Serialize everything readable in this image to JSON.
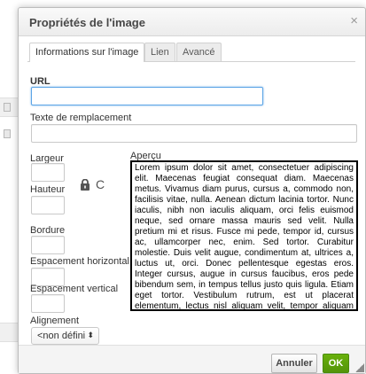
{
  "dialog": {
    "title": "Propriétés de l'image",
    "close_glyph": "×"
  },
  "tabs": [
    {
      "label": "Informations sur l'image",
      "active": true
    },
    {
      "label": "Lien",
      "active": false
    },
    {
      "label": "Avancé",
      "active": false
    }
  ],
  "fields": {
    "url": {
      "label": "URL",
      "value": ""
    },
    "alt_text": {
      "label": "Texte de remplacement",
      "value": ""
    },
    "width": {
      "label": "Largeur",
      "value": ""
    },
    "height": {
      "label": "Hauteur",
      "value": ""
    },
    "border": {
      "label": "Bordure",
      "value": ""
    },
    "hspace": {
      "label": "Espacement horizontal",
      "value": ""
    },
    "vspace": {
      "label": "Espacement vertical",
      "value": ""
    },
    "alignment": {
      "label": "Alignement",
      "selected": "<non défini",
      "arrow": "⬍"
    }
  },
  "icons": {
    "lock": "lock-icon",
    "reset_size": "refresh-icon",
    "reset_glyph": "C"
  },
  "preview": {
    "label": "Aperçu",
    "text": "Lorem ipsum dolor sit amet, consectetuer adipiscing elit. Maecenas feugiat consequat diam. Maecenas metus. Vivamus diam purus, cursus a, commodo non, facilisis vitae, nulla. Aenean dictum lacinia tortor. Nunc iaculis, nibh non iaculis aliquam, orci felis euismod neque, sed ornare massa mauris sed velit. Nulla pretium mi et risus. Fusce mi pede, tempor id, cursus ac, ullamcorper nec, enim. Sed tortor. Curabitur molestie. Duis velit augue, condimentum at, ultrices a, luctus ut, orci. Donec pellentesque egestas eros. Integer cursus, augue in cursus faucibus, eros pede bibendum sem, in tempus tellus justo quis ligula. Etiam eget tortor. Vestibulum rutrum, est ut placerat elementum, lectus nisl aliquam velit, tempor aliquam eros nunc nonummy metus. In eros metus, gravida a, gravida sed, lobortis id, turpis. Ut"
  },
  "buttons": {
    "cancel": "Annuler",
    "ok": "OK"
  },
  "colors": {
    "accent_ok": "#5ea10b",
    "focus_border": "#5da5e6"
  }
}
